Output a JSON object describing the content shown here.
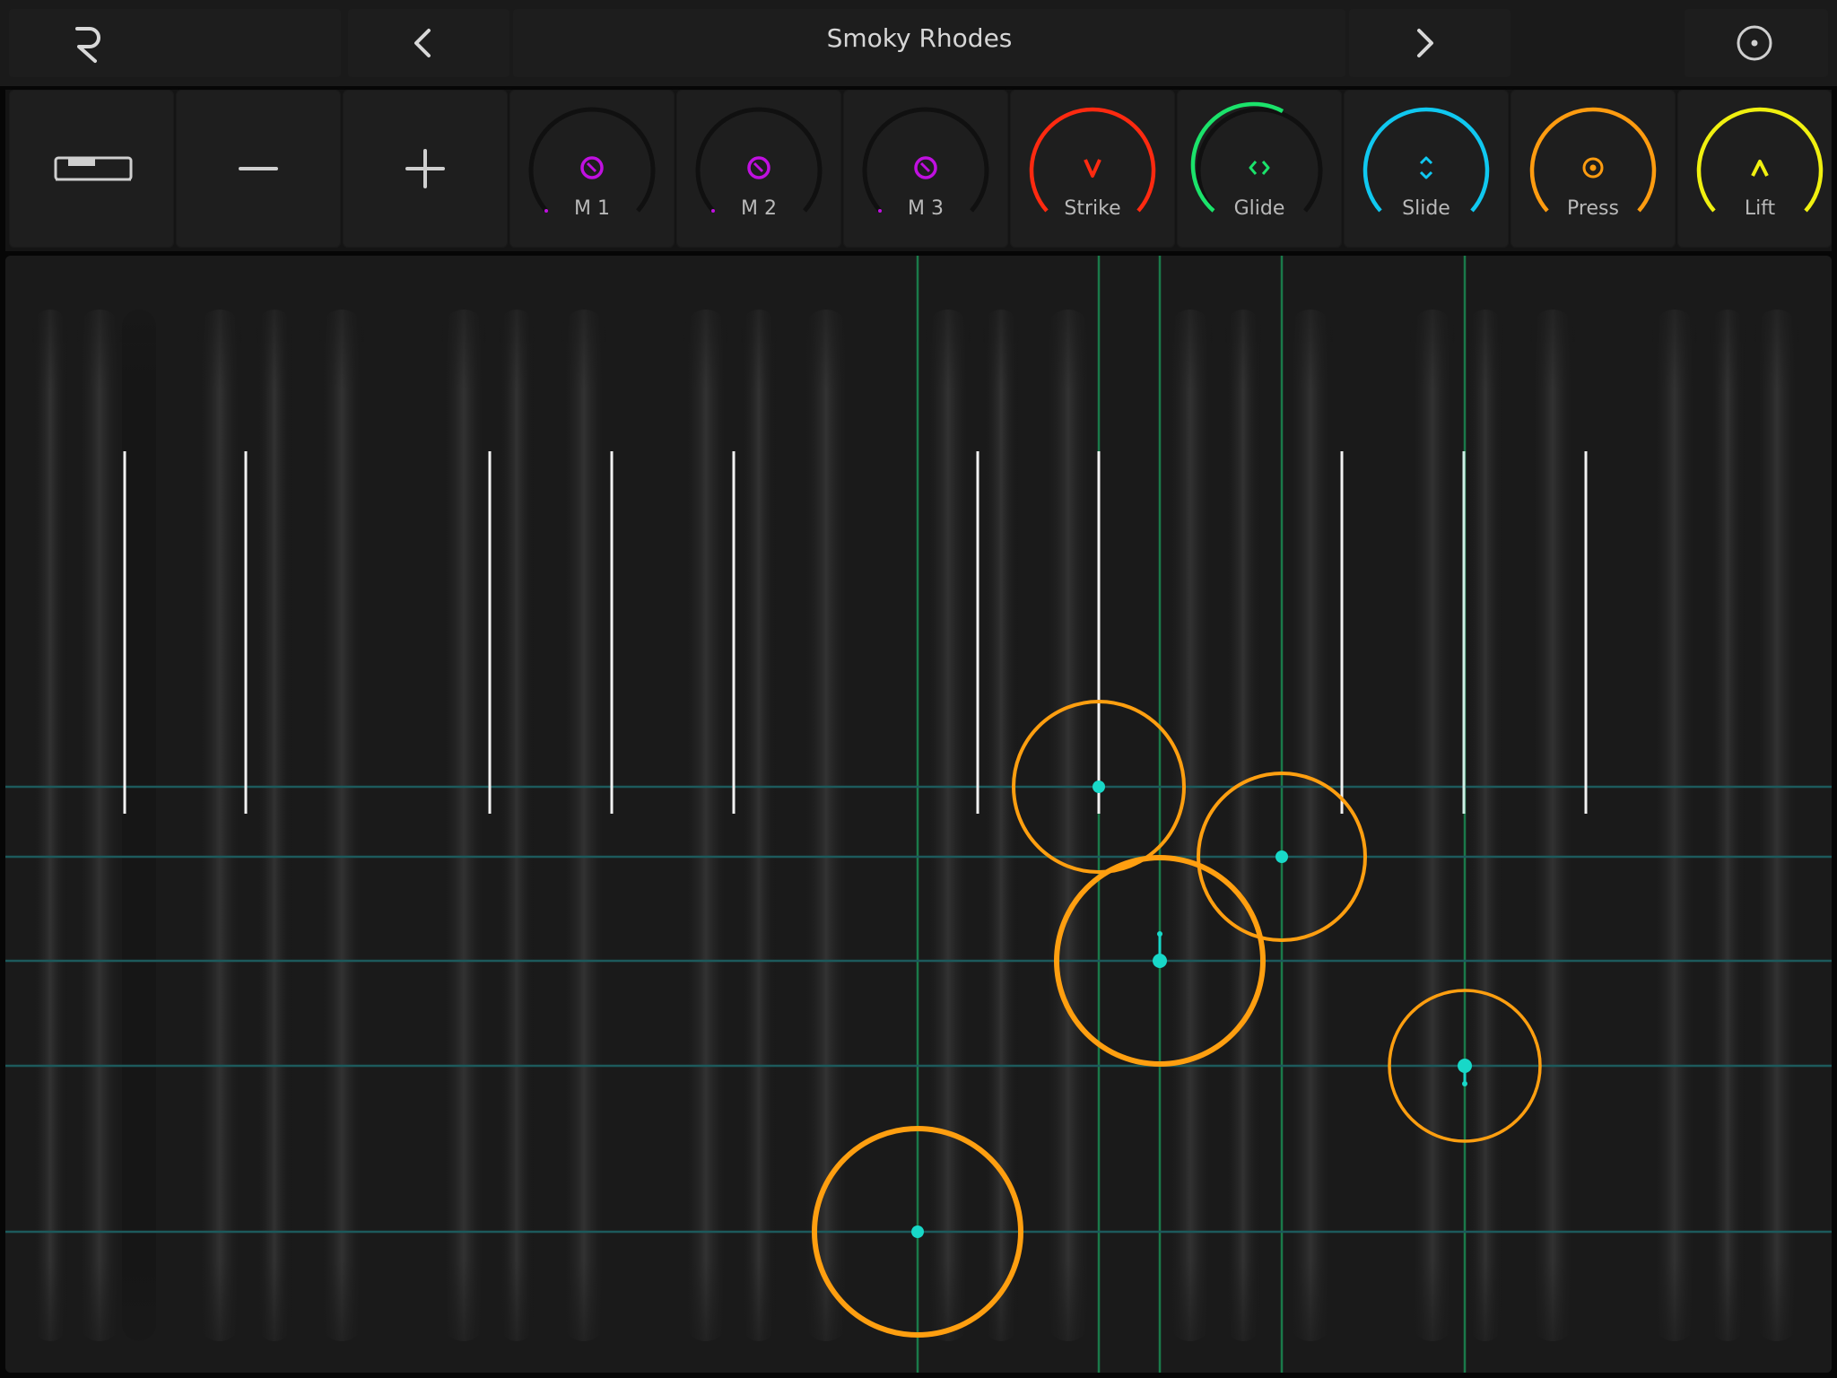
{
  "app": {
    "preset_name": "Smoky Rhodes"
  },
  "topbar": {
    "logo_icon": "roli-logo-icon",
    "prev_icon": "chevron-left-icon",
    "next_icon": "chevron-right-icon",
    "settings_icon": "record-circle-icon"
  },
  "controls": {
    "keyboard_icon": "keyboard-layout-icon",
    "minus_icon": "minus-icon",
    "plus_icon": "plus-icon",
    "knobs": [
      {
        "label": "M 1",
        "color": "#c010e0",
        "icon": "macro-knob-icon"
      },
      {
        "label": "M 2",
        "color": "#c010e0",
        "icon": "macro-knob-icon"
      },
      {
        "label": "M 3",
        "color": "#c010e0",
        "icon": "macro-knob-icon"
      },
      {
        "label": "Strike",
        "color": "#ff2a10",
        "icon": "strike-icon"
      },
      {
        "label": "Glide",
        "color": "#1be36b",
        "icon": "glide-icon"
      },
      {
        "label": "Slide",
        "color": "#10c8f0",
        "icon": "slide-icon"
      },
      {
        "label": "Press",
        "color": "#ff9c10",
        "icon": "press-icon"
      },
      {
        "label": "Lift",
        "color": "#f0f010",
        "icon": "lift-icon"
      }
    ]
  },
  "colors": {
    "touch_ring": "#ff9f10",
    "touch_dot": "#18d8c8",
    "grid_h": "#1d5a5c",
    "grid_v": "#1a7a4a"
  }
}
